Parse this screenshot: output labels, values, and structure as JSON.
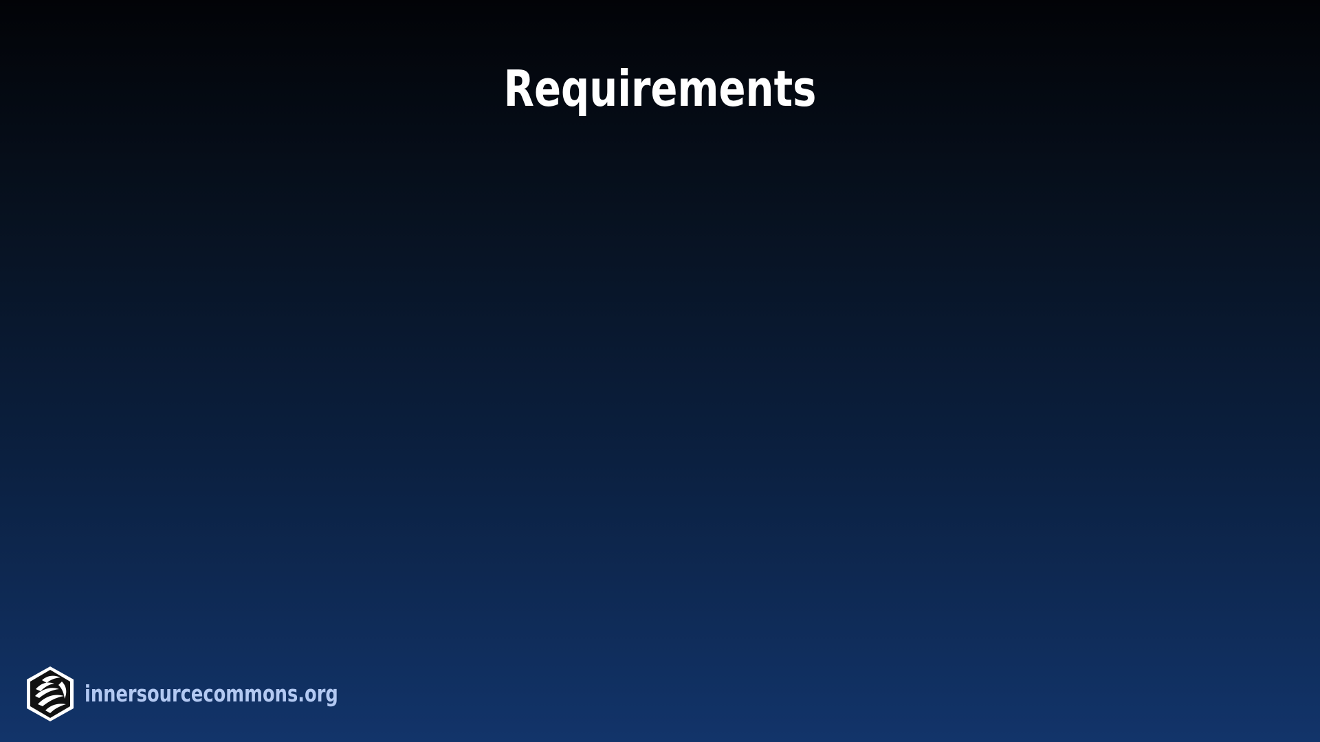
{
  "slide": {
    "title": "Requirements"
  },
  "footer": {
    "logo_icon": "innersource-commons-logo-icon",
    "url_text": "innersourcecommons.org"
  },
  "colors": {
    "background_top": "#020307",
    "background_bottom": "#12346a",
    "title": "#ffffff",
    "footer_text": "#b3c9f2"
  }
}
